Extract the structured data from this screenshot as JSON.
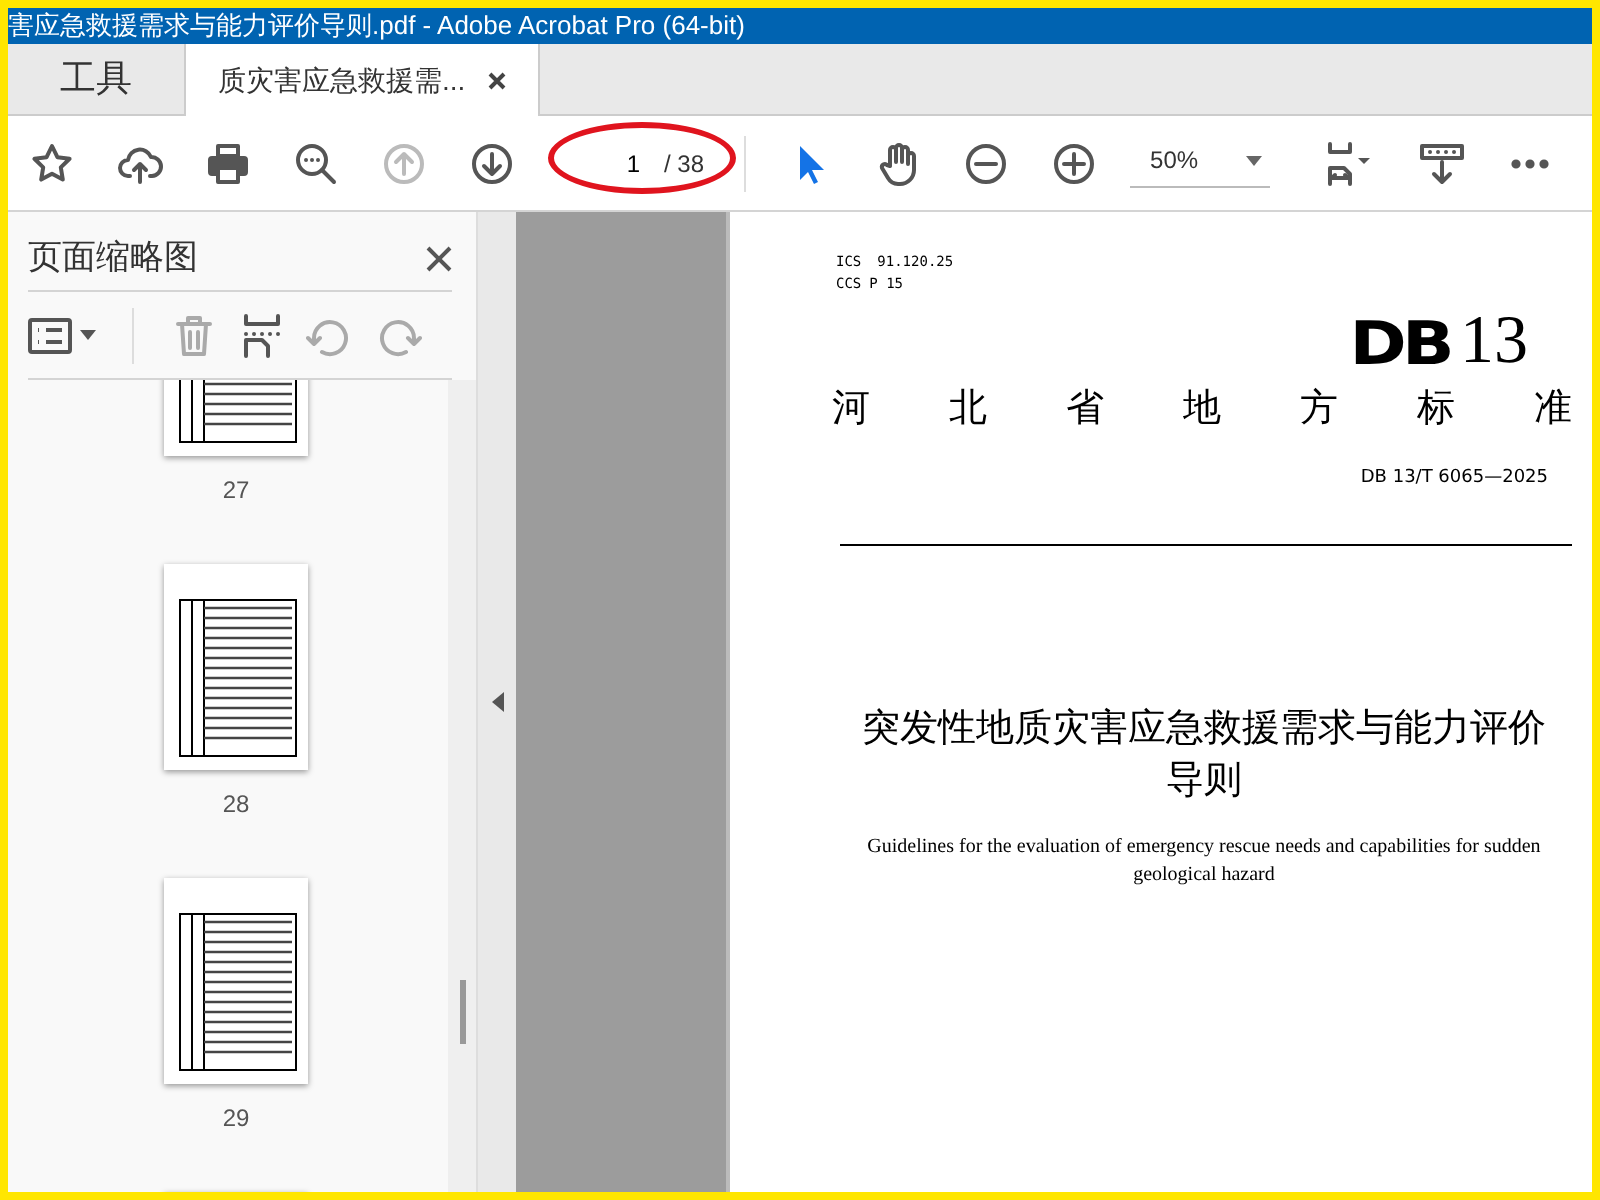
{
  "window": {
    "title": "害应急救援需求与能力评价导则.pdf - Adobe Acrobat Pro (64-bit)"
  },
  "tabs": [
    {
      "label": "工具",
      "selected": false,
      "closable": false
    },
    {
      "label": "质灾害应急救援需...",
      "selected": true,
      "closable": true
    }
  ],
  "toolbar": {
    "page": "1",
    "total": "/ 38",
    "previous_disabled": true,
    "select_tool_selected": true,
    "zoom": "50%"
  },
  "annotation": {
    "kind": "ellipse",
    "color": "#e0141e"
  },
  "sidebar": {
    "title": "页面缩略图",
    "thumbnails": [
      {
        "label": "27",
        "selected": false
      },
      {
        "label": "28",
        "selected": false
      },
      {
        "label": "29",
        "selected": false
      }
    ]
  },
  "document": {
    "ics_label": "ICS",
    "ics_value": "91.120.25",
    "ccs_label": "CCS",
    "ccs_value": "P 15",
    "logo_letters": "DB",
    "logo_number": "13",
    "issuer": "河北省地方标准",
    "code": "DB 13/T 6065—2025",
    "title_zh": "突发性地质灾害应急救援需求与能力评价导则",
    "title_en": "Guidelines for the evaluation of emergency rescue needs and capabilities for sudden geological hazard"
  }
}
